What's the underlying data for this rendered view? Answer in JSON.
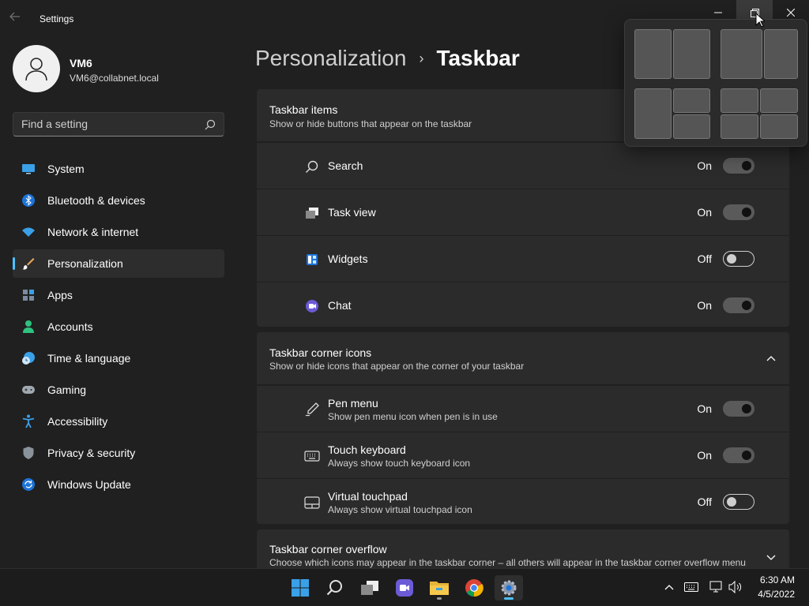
{
  "window": {
    "title": "Settings"
  },
  "user": {
    "name": "VM6",
    "email": "VM6@collabnet.local"
  },
  "search": {
    "placeholder": "Find a setting"
  },
  "sidebar": {
    "items": [
      {
        "label": "System",
        "icon": "monitor-icon"
      },
      {
        "label": "Bluetooth & devices",
        "icon": "bluetooth-icon"
      },
      {
        "label": "Network & internet",
        "icon": "wifi-icon"
      },
      {
        "label": "Personalization",
        "icon": "brush-icon",
        "active": true
      },
      {
        "label": "Apps",
        "icon": "apps-icon"
      },
      {
        "label": "Accounts",
        "icon": "person-icon"
      },
      {
        "label": "Time & language",
        "icon": "clock-globe-icon"
      },
      {
        "label": "Gaming",
        "icon": "gamepad-icon"
      },
      {
        "label": "Accessibility",
        "icon": "accessibility-icon"
      },
      {
        "label": "Privacy & security",
        "icon": "shield-icon"
      },
      {
        "label": "Windows Update",
        "icon": "update-icon"
      }
    ]
  },
  "breadcrumb": {
    "parent": "Personalization",
    "separator": "›",
    "current": "Taskbar"
  },
  "taskbar_items": {
    "title": "Taskbar items",
    "subtitle": "Show or hide buttons that appear on the taskbar",
    "rows": [
      {
        "label": "Search",
        "state": "On",
        "on": true,
        "icon": "search-icon"
      },
      {
        "label": "Task view",
        "state": "On",
        "on": true,
        "icon": "task-view-icon"
      },
      {
        "label": "Widgets",
        "state": "Off",
        "on": false,
        "icon": "widgets-icon"
      },
      {
        "label": "Chat",
        "state": "On",
        "on": true,
        "icon": "chat-icon"
      }
    ]
  },
  "corner_icons": {
    "title": "Taskbar corner icons",
    "subtitle": "Show or hide icons that appear on the corner of your taskbar",
    "rows": [
      {
        "label": "Pen menu",
        "sub": "Show pen menu icon when pen is in use",
        "state": "On",
        "on": true,
        "icon": "pen-icon"
      },
      {
        "label": "Touch keyboard",
        "sub": "Always show touch keyboard icon",
        "state": "On",
        "on": true,
        "icon": "keyboard-icon"
      },
      {
        "label": "Virtual touchpad",
        "sub": "Always show virtual touchpad icon",
        "state": "Off",
        "on": false,
        "icon": "touchpad-icon"
      }
    ]
  },
  "corner_overflow": {
    "title": "Taskbar corner overflow",
    "subtitle": "Choose which icons may appear in the taskbar corner – all others will appear in the taskbar corner overflow menu"
  },
  "clock": {
    "time": "6:30 AM",
    "date": "4/5/2022"
  },
  "colors": {
    "accent": "#4cc2ff",
    "background": "#202020",
    "card": "#2b2b2b"
  }
}
